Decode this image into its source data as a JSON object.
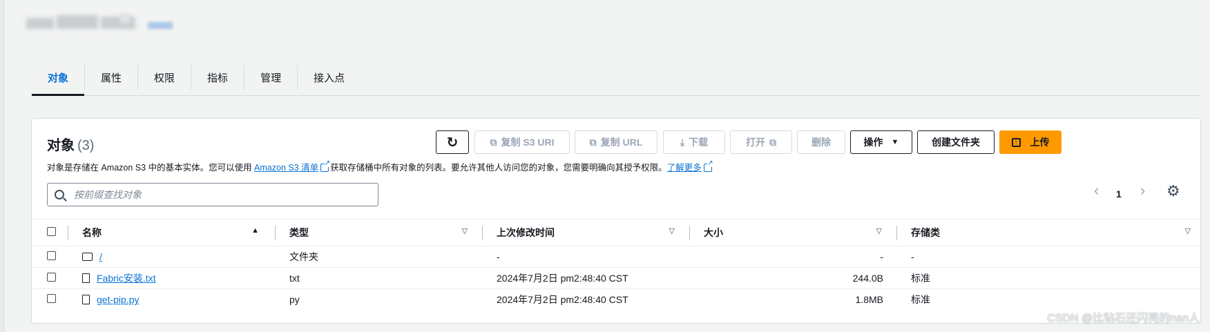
{
  "tabs": [
    "对象",
    "属性",
    "权限",
    "指标",
    "管理",
    "接入点"
  ],
  "panel": {
    "title": "对象",
    "count": "(3)",
    "desc_before": "对象是存储在 Amazon S3 中的基本实体。您可以使用 ",
    "desc_link1": "Amazon S3 清单",
    "desc_middle": "获取存储桶中所有对象的列表。要允许其他人访问您的对象，您需要明确向其授予权限。",
    "desc_link2": "了解更多"
  },
  "toolbar": {
    "refresh_icon": "refresh-icon",
    "copy_s3_uri": "复制 S3 URI",
    "copy_url": "复制 URL",
    "download": "下载",
    "open": "打开",
    "delete": "删除",
    "actions": "操作",
    "create_folder": "创建文件夹",
    "upload": "上传"
  },
  "search": {
    "placeholder": "按前缀查找对象"
  },
  "pagination": {
    "page": "1"
  },
  "table": {
    "headers": {
      "name": "名称",
      "type": "类型",
      "modified": "上次修改时间",
      "size": "大小",
      "storage": "存储类"
    },
    "rows": [
      {
        "name": "/",
        "type": "文件夹",
        "modified": "-",
        "size": "-",
        "storage": "-"
      },
      {
        "name": "Fabric安装.txt",
        "type": "txt",
        "modified": "2024年7月2日 pm2:48:40 CST",
        "size": "244.0B",
        "storage": "标准"
      },
      {
        "name": "get-pip.py",
        "type": "py",
        "modified": "2024年7月2日 pm2:48:40 CST",
        "size": "1.8MB",
        "storage": "标准"
      }
    ]
  },
  "watermark": "CSDN @比钻石还闪亮的nan人",
  "colors": {
    "accent": "#0972d3",
    "primary_button": "#ff9900"
  }
}
